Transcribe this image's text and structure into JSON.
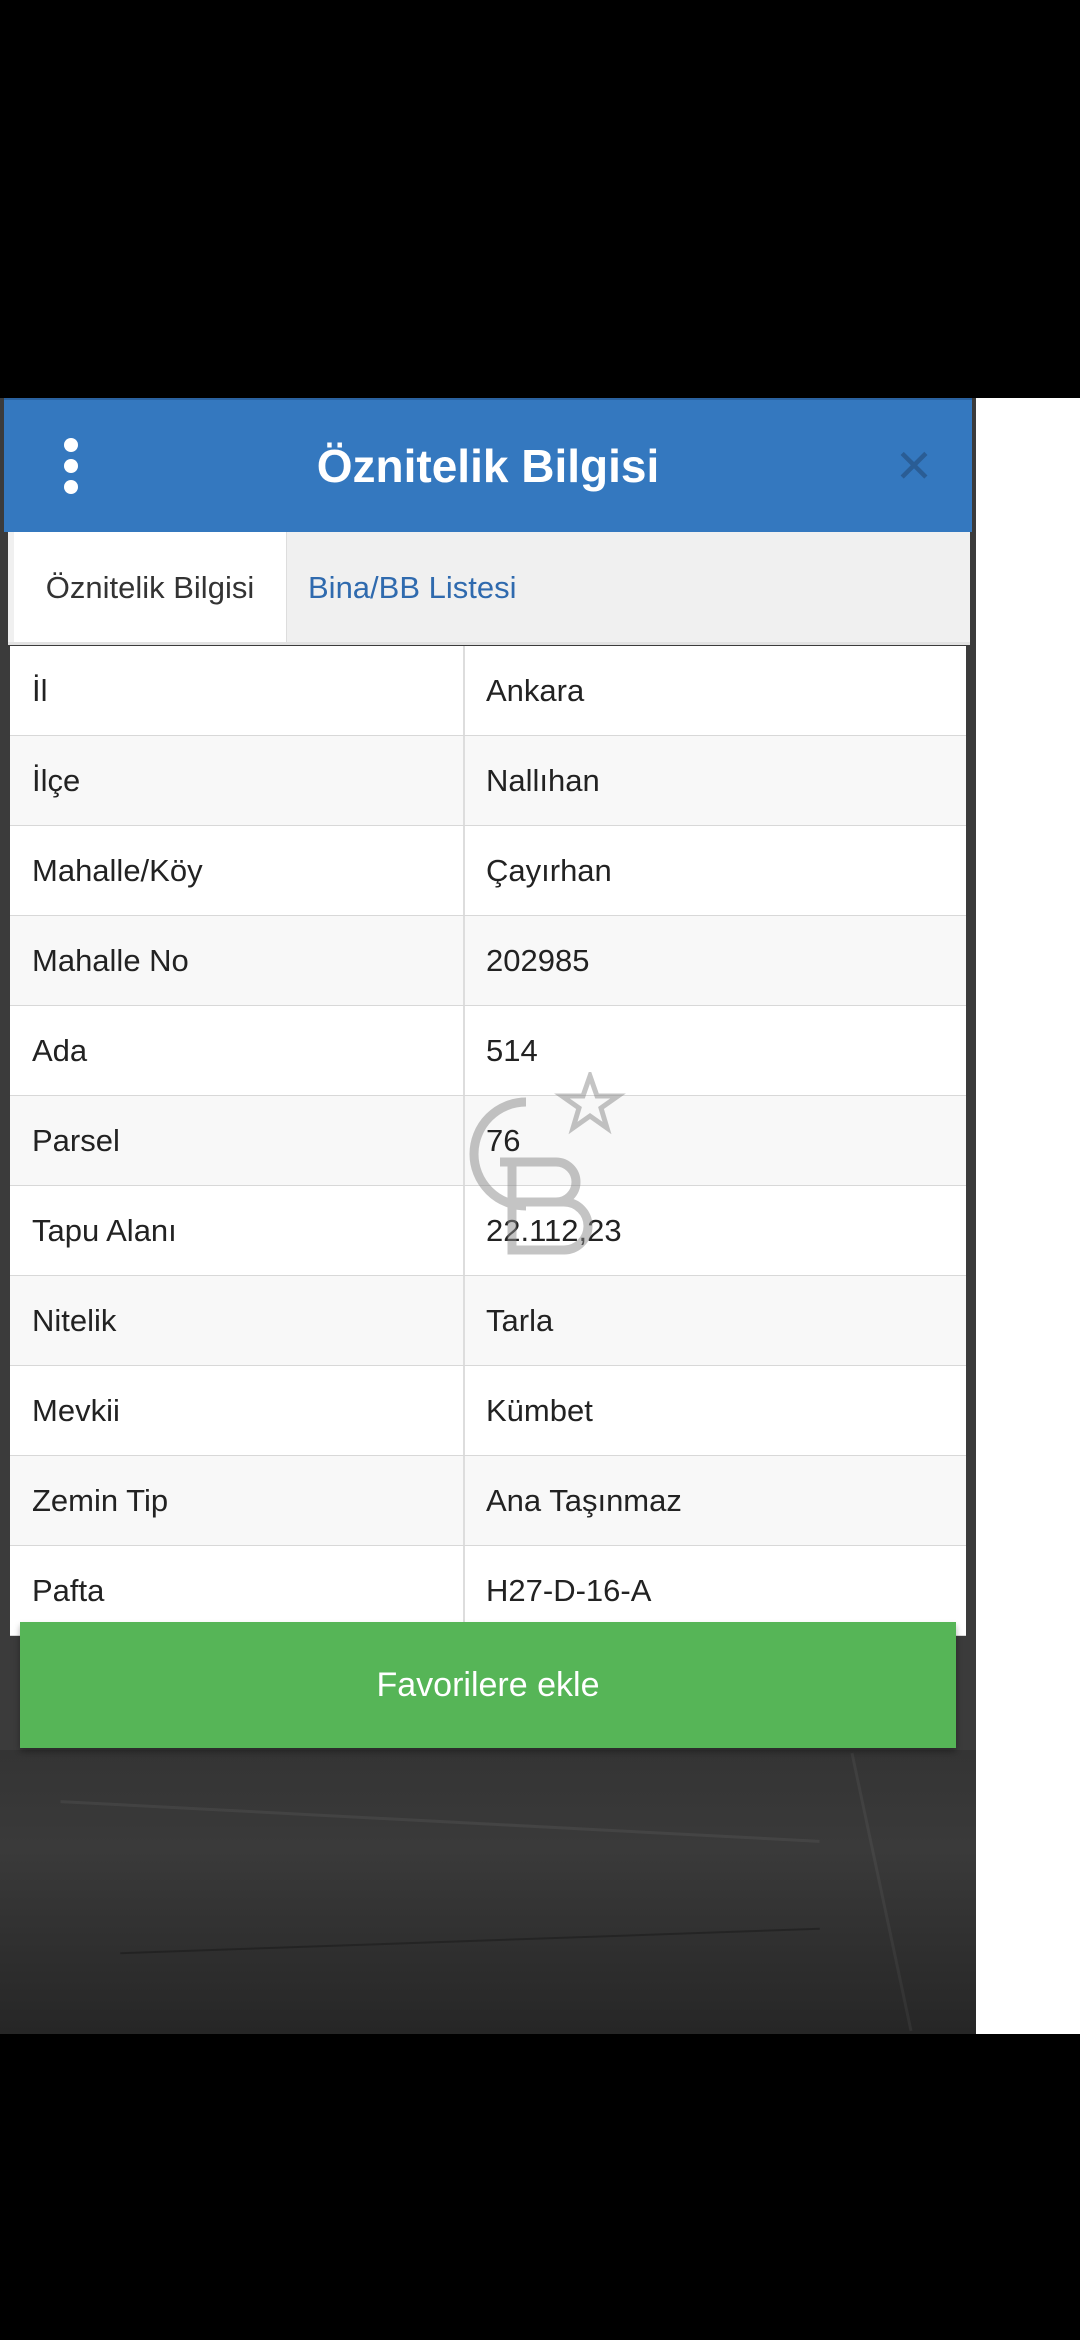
{
  "header": {
    "title": "Öznitelik Bilgisi",
    "close_symbol": "✕"
  },
  "tabs": [
    {
      "label": "Öznitelik Bilgisi",
      "active": true
    },
    {
      "label": "Bina/BB Listesi",
      "active": false
    }
  ],
  "rows": [
    {
      "label": "İl",
      "value": "Ankara"
    },
    {
      "label": "İlçe",
      "value": "Nallıhan"
    },
    {
      "label": "Mahalle/Köy",
      "value": "Çayırhan"
    },
    {
      "label": "Mahalle No",
      "value": "202985"
    },
    {
      "label": "Ada",
      "value": "514"
    },
    {
      "label": "Parsel",
      "value": "76"
    },
    {
      "label": "Tapu Alanı",
      "value": "22.112,23"
    },
    {
      "label": "Nitelik",
      "value": "Tarla"
    },
    {
      "label": "Mevkii",
      "value": "Kümbet"
    },
    {
      "label": "Zemin Tip",
      "value": "Ana Taşınmaz"
    },
    {
      "label": "Pafta",
      "value": "H27-D-16-A"
    }
  ],
  "footer": {
    "favorite_button_label": "Favorilere ekle"
  },
  "icons": {
    "menu": "kebab-menu-icon",
    "close": "close-icon",
    "watermark": "cb-logo-watermark"
  },
  "colors": {
    "header": "#3478bf",
    "tab_link": "#2f6aae",
    "favorite_button": "#56b557"
  }
}
